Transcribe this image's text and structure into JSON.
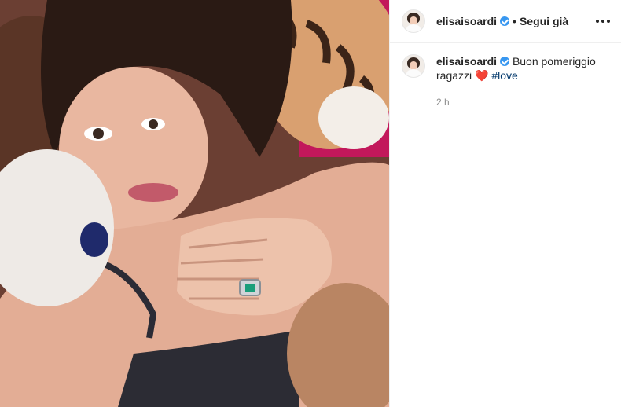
{
  "post": {
    "author": {
      "username": "elisaisoardi",
      "verified": true
    },
    "follow_status": "Segui già",
    "separator": "•",
    "caption": {
      "username": "elisaisoardi",
      "text": "Buon pomeriggio ragazzi",
      "emoji": "❤️",
      "hashtag": "#love"
    },
    "timestamp": "2 h"
  },
  "icons": {
    "verified": "verified-badge-icon",
    "more": "more-options-icon"
  },
  "colors": {
    "verified_blue": "#3897f0",
    "hashtag_blue": "#00376b",
    "heart_red": "#ed1c24",
    "muted_gray": "#8e8e8e"
  }
}
